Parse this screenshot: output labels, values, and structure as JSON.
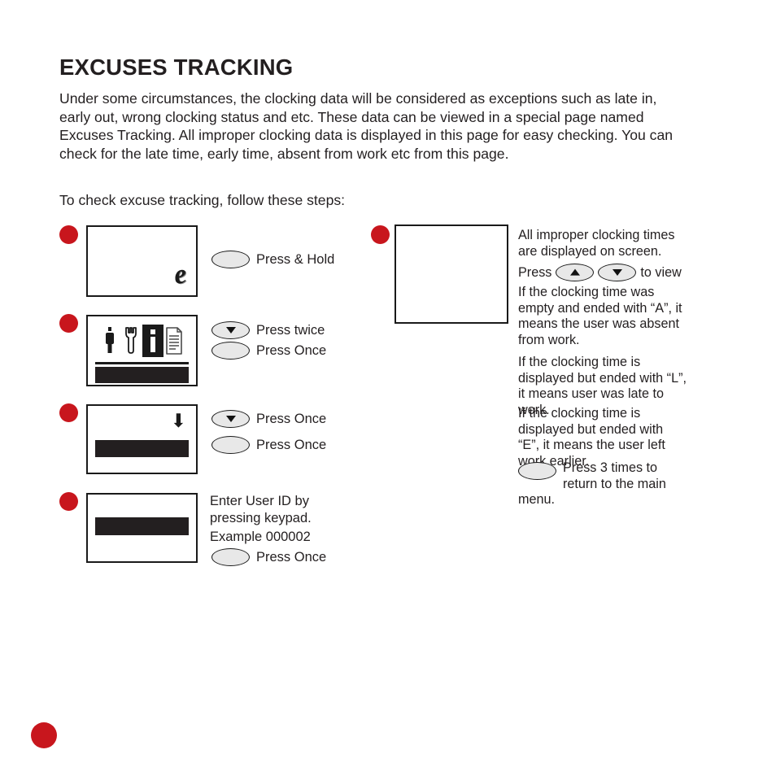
{
  "document": {
    "title": "EXCUSES TRACKING",
    "intro": "Under some circumstances, the clocking data will be considered as exceptions such as late in, early out, wrong clocking status and etc. These data can be viewed in a special page named Excuses Tracking. All improper clocking data is displayed in this page for easy checking. You can check for the late time, early time, absent from work etc from this page.",
    "sub_intro": "To check excuse tracking, follow these steps:"
  },
  "colors": {
    "bullet_red": "#c8161d",
    "ink": "#231f20",
    "key_fill": "#e8e8e8",
    "screen_border": "#1a1a1a"
  },
  "steps": [
    {
      "id": "step-1",
      "screen": {
        "logo": "e"
      },
      "keys": [
        {
          "icon": "plain-key",
          "label": "Press & Hold"
        }
      ]
    },
    {
      "id": "step-2",
      "screen": {
        "icons": [
          "person-icon",
          "wrench-icon",
          "info-icon",
          "document-icon"
        ],
        "selected_icon": "info-icon"
      },
      "keys": [
        {
          "icon": "down-arrow-key",
          "label": "Press twice"
        },
        {
          "icon": "plain-key",
          "label": "Press Once"
        }
      ]
    },
    {
      "id": "step-3",
      "screen": {
        "glyph": "down-arrow"
      },
      "keys": [
        {
          "icon": "down-arrow-key",
          "label": "Press Once"
        },
        {
          "icon": "plain-key",
          "label": "Press Once"
        }
      ]
    },
    {
      "id": "step-4",
      "screen": {
        "highlight_bar": true
      },
      "note_line_1": "Enter User ID by",
      "note_line_2": "pressing keypad.",
      "note_line_3": "Example 000002",
      "keys": [
        {
          "icon": "plain-key",
          "label": "Press Once"
        }
      ]
    }
  ],
  "right_column": {
    "bullet": true,
    "paragraph_1": "All improper clocking times are displayed on screen.",
    "press_prefix": "Press",
    "press_suffix": "to view",
    "up_key": "up-arrow-key",
    "down_key": "down-arrow-key",
    "paragraph_2": "If the clocking time was empty and ended with “A”, it means the user was absent from work.",
    "paragraph_3": "If the clocking time is displayed but ended with “L”, it means user was late to work.",
    "paragraph_4": "If the clocking time is displayed but ended with “E”, it means the user left work earlier.",
    "return_text": "Press 3 times to return to the main menu."
  }
}
